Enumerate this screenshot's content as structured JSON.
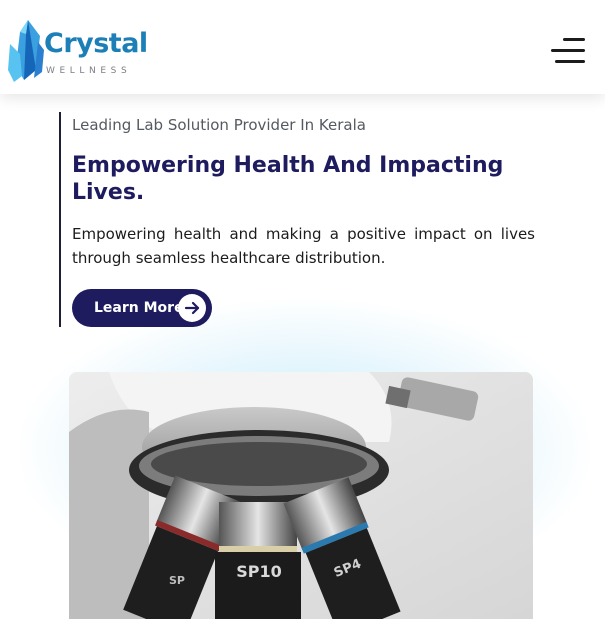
{
  "header": {
    "logo_text": "Crystal",
    "logo_subtext": "WELLNESS",
    "brand_color": "#1c7fb8",
    "menu_icon": "hamburger-menu-icon"
  },
  "hero": {
    "kicker": "Leading Lab Solution Provider In Kerala",
    "headline": "Empowering Health And Impacting Lives.",
    "description": "Empowering health and making a positive impact on lives through seamless healthcare distribution.",
    "cta_label": "Learn More",
    "cta_icon": "arrow-right-icon",
    "accent_color": "#1e1b5e"
  },
  "photo": {
    "subject": "microscope-image",
    "lens_labels": [
      "SP10",
      "SP4",
      "SP"
    ]
  }
}
